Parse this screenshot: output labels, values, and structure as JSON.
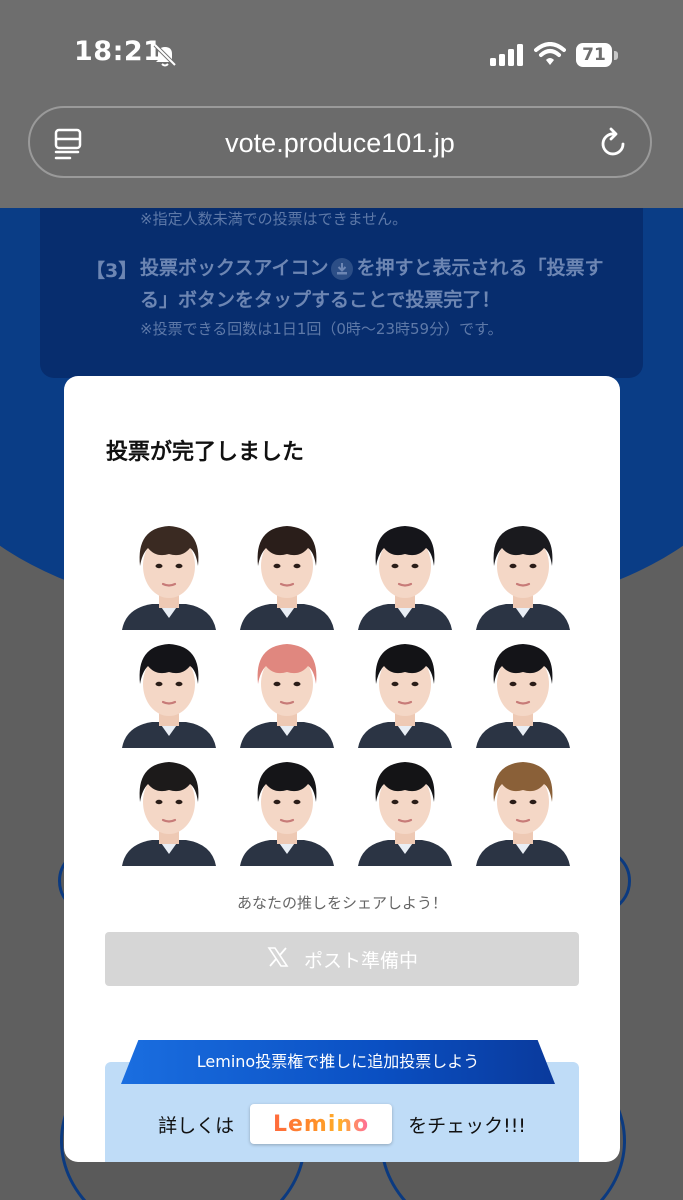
{
  "status_bar": {
    "time": "18:21",
    "battery": "71"
  },
  "browser": {
    "url": "vote.produce101.jp"
  },
  "background_page": {
    "note_top": "※指定人数未満での投票はできません。",
    "step3_number": "【3】",
    "step3_text_a": "投票ボックスアイコン",
    "step3_text_b": "を押すと表示される「投票する」ボタンをタップすることで投票完了！",
    "note_bottom": "※投票できる回数は1日1回（0時〜23時59分）です。"
  },
  "modal": {
    "title": "投票が完了しました",
    "faces": [
      {
        "hair": "#3a2a22",
        "label": "trainee-1"
      },
      {
        "hair": "#2a1e1a",
        "label": "trainee-2"
      },
      {
        "hair": "#15151a",
        "label": "trainee-3"
      },
      {
        "hair": "#1a1a1e",
        "label": "trainee-4"
      },
      {
        "hair": "#141418",
        "label": "trainee-5"
      },
      {
        "hair": "#e0877f",
        "label": "trainee-6"
      },
      {
        "hair": "#131316",
        "label": "trainee-7"
      },
      {
        "hair": "#141418",
        "label": "trainee-8"
      },
      {
        "hair": "#1c1a1a",
        "label": "trainee-9"
      },
      {
        "hair": "#151518",
        "label": "trainee-10"
      },
      {
        "hair": "#141416",
        "label": "trainee-11"
      },
      {
        "hair": "#8a6038",
        "label": "trainee-12"
      }
    ],
    "share_caption": "あなたの推しをシェアしよう！",
    "post_button_label": "ポスト準備中",
    "lemino_ribbon": "Lemino投票権で推しに追加投票しよう",
    "lemino_prefix": "詳しくは",
    "lemino_logo_text": "Lemino",
    "lemino_suffix": "をチェック!!!"
  },
  "colors": {
    "page_blue": "#0a3d86",
    "post_button_disabled": "#d6d6d6",
    "lemino_panel": "#bfdcf7"
  }
}
